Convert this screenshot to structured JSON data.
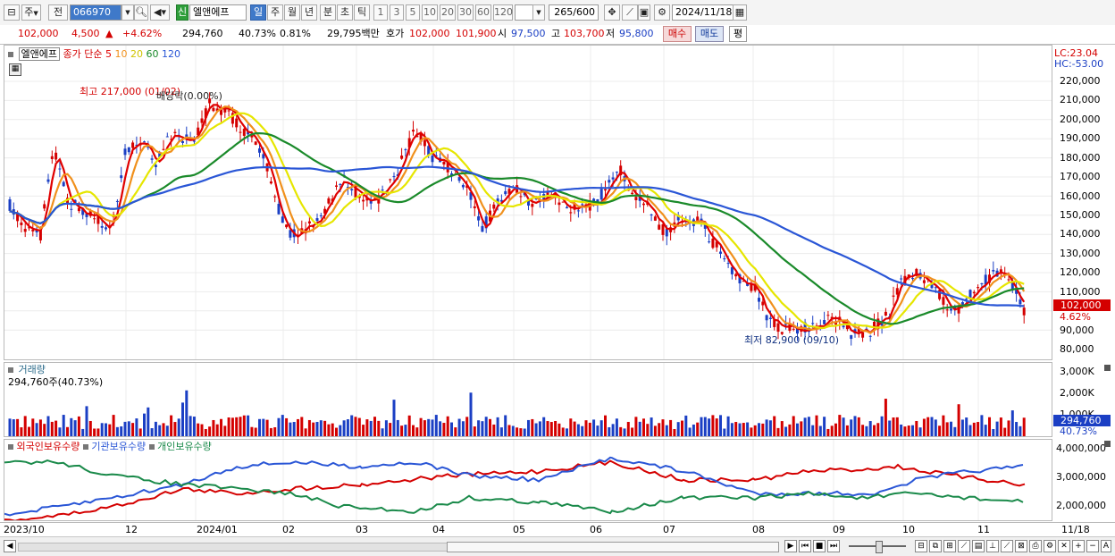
{
  "toolbar": {
    "period_type": "주",
    "prev_label": "전",
    "stock_code": "066970",
    "stock_badge": "신",
    "stock_name": "엘앤에프",
    "period_tabs": [
      "일",
      "주",
      "월",
      "년",
      "분",
      "초",
      "틱"
    ],
    "active_tab": "일",
    "interval_buttons": [
      "1",
      "3",
      "5",
      "10",
      "20",
      "30",
      "60",
      "120"
    ],
    "count_value": "265",
    "count_total": "/600",
    "date_value": "2024/11/18"
  },
  "quote": {
    "price": "102,000",
    "change": "4,500",
    "change_pct": "+4.62%",
    "volume": "294,760",
    "volume_ratio": "40.73%",
    "turnover": "0.81%",
    "amount": "29,795백만",
    "bid_label": "호가",
    "ask_price": "102,000",
    "bid_price": "101,900",
    "open_label": "시",
    "open": "97,500",
    "high_label": "고",
    "high": "103,700",
    "low_label": "저",
    "low": "95,800",
    "buy_label": "매수",
    "sell_label": "매도",
    "eval_label": "평"
  },
  "price_panel": {
    "name": "엘앤에프",
    "indicator_label": "종가 단순",
    "ma_periods": [
      "5",
      "10",
      "20",
      "60",
      "120"
    ],
    "ma_colors": [
      "#e00000",
      "#f0901c",
      "#e6e600",
      "#1a8a2a",
      "#2a56d6"
    ],
    "high_annotation": "최고 217,000 (01/02)",
    "dividend_annotation": "배당락(0.00%)",
    "low_annotation": "최저 82,900 (09/10)",
    "lc": "LC:23.04",
    "hc": "HC:-53.00",
    "y_ticks": [
      "220,000",
      "210,000",
      "200,000",
      "190,000",
      "180,000",
      "170,000",
      "160,000",
      "150,000",
      "140,000",
      "130,000",
      "120,000",
      "110,000",
      "90,000",
      "80,000"
    ],
    "current_price": "102,000",
    "current_pct": "4.62%"
  },
  "volume_panel": {
    "name": "거래량",
    "value_text": "294,760주(40.73%)",
    "y_ticks": [
      "3,000K",
      "2,000K",
      "1,000K"
    ],
    "current_volume": "294,760",
    "current_pct": "40.73%"
  },
  "holding_panel": {
    "legends": [
      "외국인보유수량",
      "기관보유수량",
      "개인보유수량"
    ],
    "legend_colors": [
      "#d40000",
      "#2a56d6",
      "#1a8a4a"
    ],
    "y_ticks": [
      "4,000,000",
      "3,000,000",
      "2,000,000"
    ]
  },
  "x_axis": {
    "labels": [
      "2023/10",
      "12",
      "2024/01",
      "02",
      "03",
      "04",
      "05",
      "06",
      "07",
      "08",
      "09",
      "10",
      "11"
    ],
    "right_label": "11/18"
  },
  "colors": {
    "up": "#d40000",
    "down": "#1b3fc4",
    "active": "#3f79c9"
  }
}
